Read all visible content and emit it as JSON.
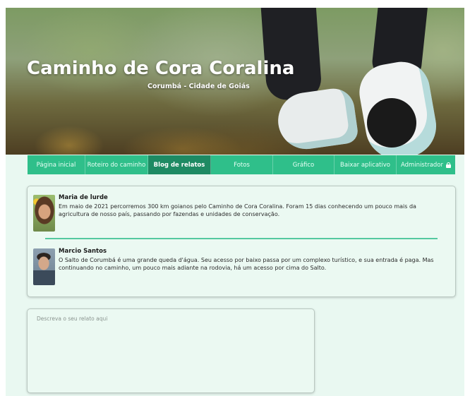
{
  "hero": {
    "title": "Caminho de Cora Coralina",
    "subtitle": "Corumbá - Cidade de Goiás"
  },
  "nav": {
    "items": [
      {
        "label": "Página inicial",
        "active": false
      },
      {
        "label": "Roteiro do caminho",
        "active": false
      },
      {
        "label": "Blog de relatos",
        "active": true
      },
      {
        "label": "Fotos",
        "active": false
      },
      {
        "label": "Gráfico",
        "active": false
      },
      {
        "label": "Baixar aplicativo",
        "active": false
      },
      {
        "label": "Administrador",
        "active": false,
        "icon": "lock-icon"
      }
    ]
  },
  "posts": [
    {
      "author": "Maria de lurde",
      "body": "Em maio de 2021 percorremos 300 km goianos pelo Caminho de Cora Coralina. Foram 15 dias conhecendo um pouco mais da agricultura de nosso país, passando por fazendas e unidades de conservação."
    },
    {
      "author": "Marcio Santos",
      "body": "O Salto de Corumbá é uma grande queda d'água. Seu acesso por baixo passa por um complexo turístico, e sua entrada é paga. Mas continuando no caminho, um pouco mais adiante na rodovia, há um acesso por cima do Salto."
    }
  ],
  "composer": {
    "placeholder": "Descreva o seu relato aqui",
    "value": ""
  },
  "colors": {
    "page_background": "#e9f8f1",
    "nav_background": "#2fbf8a",
    "nav_active": "#1e8a63",
    "divider": "#55c9a0"
  }
}
